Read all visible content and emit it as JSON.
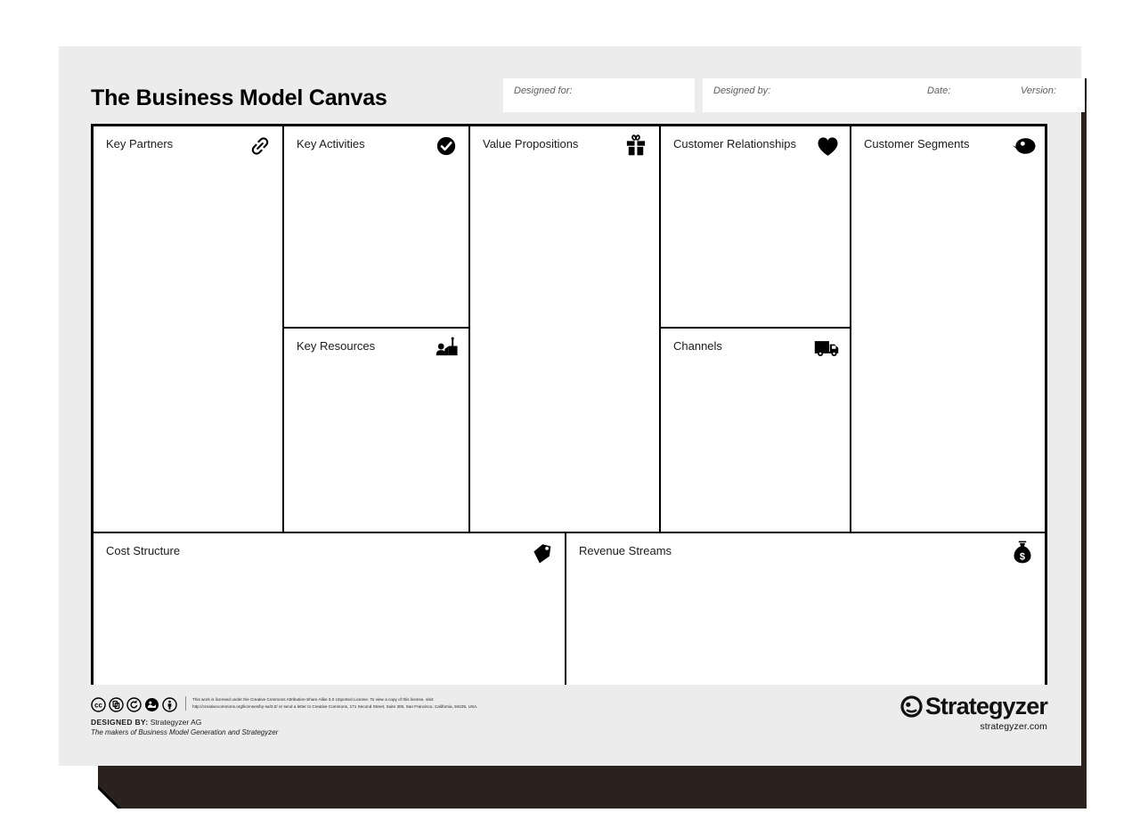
{
  "page": {
    "background": "#ffffff",
    "sheet_color": "#ececec",
    "shadow_color": "#2b211d"
  },
  "header": {
    "title": "The Business Model Canvas",
    "fields": [
      {
        "label": "Designed for:",
        "value": "",
        "name": "designed-for"
      },
      {
        "label": "Designed by:",
        "value": "",
        "name": "designed-by"
      },
      {
        "label": "Date:",
        "value": "",
        "name": "date"
      },
      {
        "label": "Version:",
        "value": "",
        "name": "version"
      }
    ]
  },
  "blocks": [
    {
      "id": "key-partners",
      "title": "Key Partners",
      "icon": "chain-link-icon",
      "value": ""
    },
    {
      "id": "key-activities",
      "title": "Key Activities",
      "icon": "check-circle-icon",
      "value": ""
    },
    {
      "id": "key-resources",
      "title": "Key Resources",
      "icon": "factory-worker-icon",
      "value": ""
    },
    {
      "id": "value-propositions",
      "title": "Value Propositions",
      "icon": "gift-box-icon",
      "value": ""
    },
    {
      "id": "customer-relationships",
      "title": "Customer Relationships",
      "icon": "heart-icon",
      "value": ""
    },
    {
      "id": "channels",
      "title": "Channels",
      "icon": "delivery-truck-icon",
      "value": ""
    },
    {
      "id": "customer-segments",
      "title": "Customer Segments",
      "icon": "person-head-icon",
      "value": ""
    },
    {
      "id": "cost-structure",
      "title": "Cost Structure",
      "icon": "price-tag-icon",
      "value": ""
    },
    {
      "id": "revenue-streams",
      "title": "Revenue Streams",
      "icon": "money-bag-icon",
      "value": ""
    }
  ],
  "footer": {
    "cc_badges": [
      "creative-commons-icon",
      "remix-icon",
      "share-alike-icon",
      "sampling-icon",
      "attribution-icon"
    ],
    "license_line_1": "This work is licensed under the Creative Commons Attribution-Share Alike 3.0 Unported License. To view a copy of this license, visit:",
    "license_line_2": "http://creativecommons.org/licenses/by-sa/3.0/ or send a letter to Creative Commons, 171 Second Street, Suite 300, San Francisco, California, 94105, USA.",
    "designed_by_label": "DESIGNED BY:",
    "designed_by_value": "Strategyzer AG",
    "tagline": "The makers of Business Model Generation and Strategyzer",
    "brand_name": "Strategyzer",
    "brand_url": "strategyzer.com"
  }
}
